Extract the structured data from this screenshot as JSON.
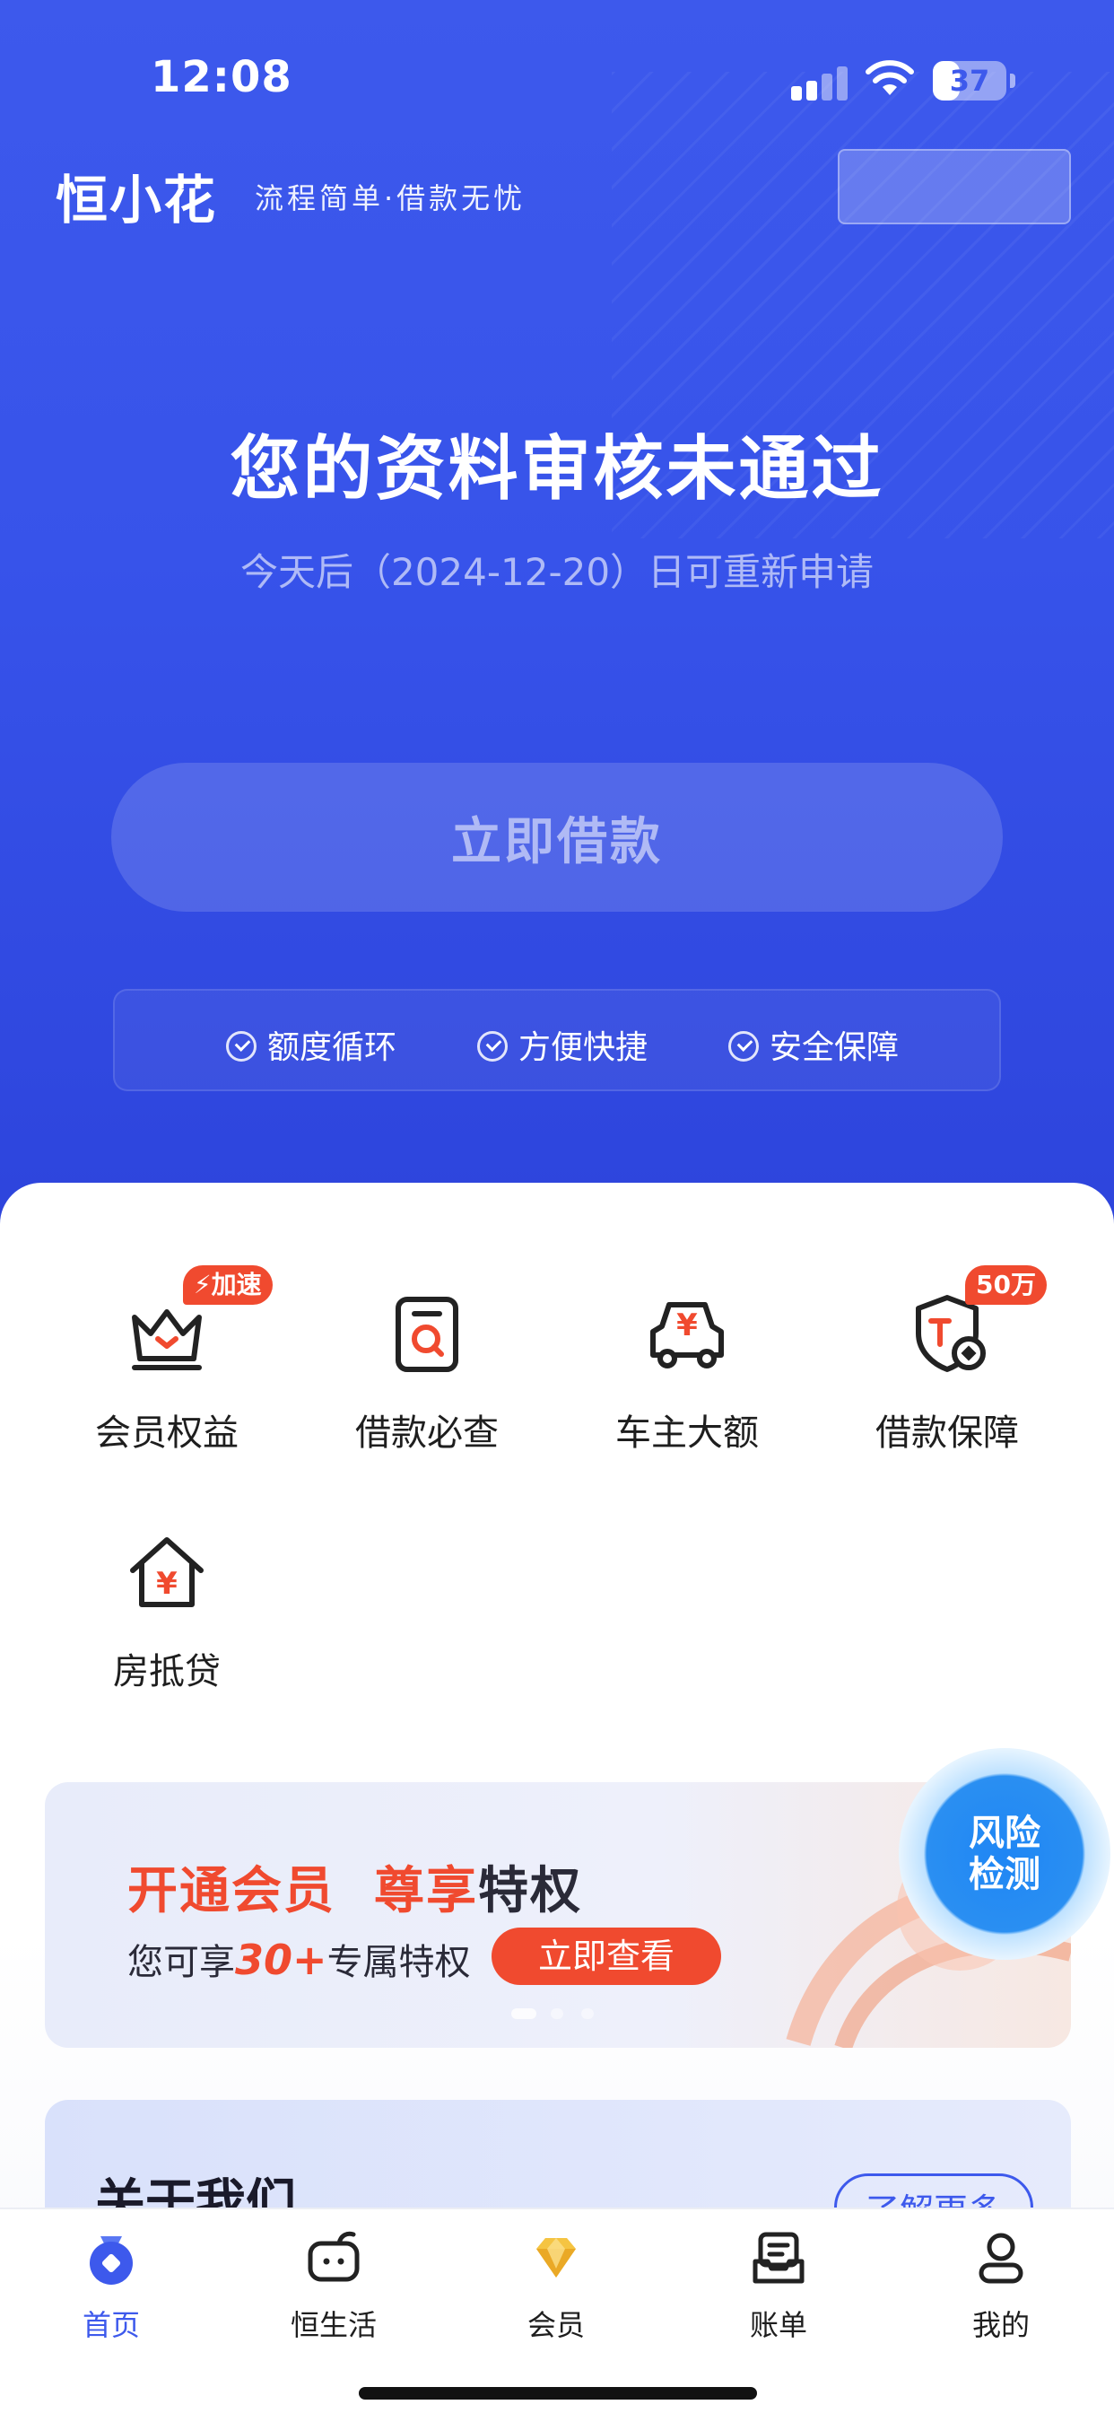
{
  "status_bar": {
    "time": "12:08",
    "battery": "37",
    "battery_level": 0.37
  },
  "brand": {
    "logo": "恒小花",
    "slogan": "流程简单·借款无忧"
  },
  "loan_status": {
    "title": "您的资料审核未通过",
    "subtitle": "今天后（2024-12-20）日可重新申请",
    "button": "立即借款"
  },
  "features": [
    "额度循环",
    "方便快捷",
    "安全保障"
  ],
  "services": [
    {
      "label": "会员权益",
      "icon": "crown-icon",
      "badge": "加速"
    },
    {
      "label": "借款必查",
      "icon": "document-search-icon",
      "badge": ""
    },
    {
      "label": "车主大额",
      "icon": "car-yuan-icon",
      "badge": ""
    },
    {
      "label": "借款保障",
      "icon": "shield-icon",
      "badge": "50万"
    },
    {
      "label": "房抵贷",
      "icon": "house-yuan-icon",
      "badge": ""
    }
  ],
  "banner": {
    "title_a": "开通会员",
    "title_b": "尊享",
    "title_c": "特权",
    "sub_a": "您可享",
    "sub_num": "30+",
    "sub_b": "专属特权",
    "button": "立即查看",
    "slide_index": 1,
    "slide_count": 3
  },
  "risk_check": {
    "label_line1": "风险",
    "label_line2": "检测"
  },
  "about": {
    "title": "关于我们",
    "more": "了解更多"
  },
  "tabs": [
    {
      "label": "首页",
      "icon": "home-wallet-icon",
      "active": true
    },
    {
      "label": "恒生活",
      "icon": "life-tv-icon",
      "active": false
    },
    {
      "label": "会员",
      "icon": "diamond-icon",
      "active": false
    },
    {
      "label": "账单",
      "icon": "bill-icon",
      "active": false
    },
    {
      "label": "我的",
      "icon": "profile-icon",
      "active": false
    }
  ],
  "colors": {
    "primary": "#3d59ec",
    "accent": "#f04a2f",
    "risk": "#2a8ff2"
  }
}
